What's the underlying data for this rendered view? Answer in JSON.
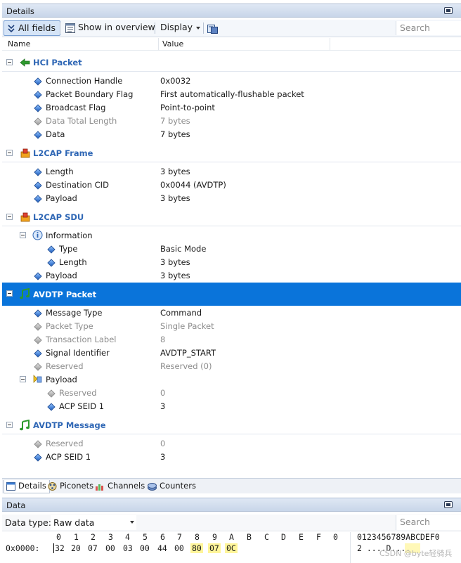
{
  "details_panel": {
    "title": "Details"
  },
  "toolbar": {
    "all_fields": "All fields",
    "show_in_overview": "Show in overview",
    "display": "Display",
    "search_placeholder": "Search"
  },
  "columns": {
    "name": "Name",
    "value": "Value"
  },
  "hci_packet": {
    "title": "HCI Packet",
    "fields": [
      {
        "name": "Connection Handle",
        "value": "0x0032"
      },
      {
        "name": "Packet Boundary Flag",
        "value": "First automatically-flushable packet"
      },
      {
        "name": "Broadcast Flag",
        "value": "Point-to-point"
      },
      {
        "name": "Data Total Length",
        "value": "7 bytes"
      },
      {
        "name": "Data",
        "value": "7 bytes"
      }
    ]
  },
  "l2cap_frame": {
    "title": "L2CAP Frame",
    "fields": [
      {
        "name": "Length",
        "value": "3 bytes"
      },
      {
        "name": "Destination CID",
        "value": "0x0044 (AVDTP)"
      },
      {
        "name": "Payload",
        "value": "3 bytes"
      }
    ]
  },
  "l2cap_sdu": {
    "title": "L2CAP SDU",
    "information": "Information",
    "info_fields": [
      {
        "name": "Type",
        "value": "Basic Mode"
      },
      {
        "name": "Length",
        "value": "3 bytes"
      }
    ],
    "payload": {
      "name": "Payload",
      "value": "3 bytes"
    }
  },
  "avdtp_packet": {
    "title": "AVDTP Packet",
    "fields": [
      {
        "name": "Message Type",
        "value": "Command"
      },
      {
        "name": "Packet Type",
        "value": "Single Packet"
      },
      {
        "name": "Transaction Label",
        "value": "8"
      },
      {
        "name": "Signal Identifier",
        "value": "AVDTP_START"
      },
      {
        "name": "Reserved",
        "value": "Reserved (0)"
      }
    ],
    "payload": "Payload",
    "payload_fields": [
      {
        "name": "Reserved",
        "value": "0"
      },
      {
        "name": "ACP SEID 1",
        "value": "3"
      }
    ]
  },
  "avdtp_message": {
    "title": "AVDTP Message",
    "fields": [
      {
        "name": "Reserved",
        "value": "0"
      },
      {
        "name": "ACP SEID 1",
        "value": "3"
      }
    ]
  },
  "tabs": [
    "Details",
    "Piconets",
    "Channels",
    "Counters"
  ],
  "data_panel": {
    "title": "Data",
    "data_type_label": "Data type:",
    "data_type_value": "Raw data",
    "search_placeholder": "Search",
    "hex_header": [
      "0",
      "1",
      "2",
      "3",
      "4",
      "5",
      "6",
      "7",
      "8",
      "9",
      "A",
      "B",
      "C",
      "D",
      "E",
      "F",
      "0"
    ],
    "ascii_header": "0123456789ABCDEF0",
    "offset": "0x0000:",
    "bytes": [
      "32",
      "20",
      "07",
      "00",
      "03",
      "00",
      "44",
      "00",
      "80",
      "07",
      "0C"
    ],
    "ascii": "2 ....D...."
  },
  "watermark": "CSDN @byte轻骑兵",
  "colors": {
    "selection": "#0a74da",
    "section_title": "#2f67b5",
    "highlight": "#fff59a"
  }
}
